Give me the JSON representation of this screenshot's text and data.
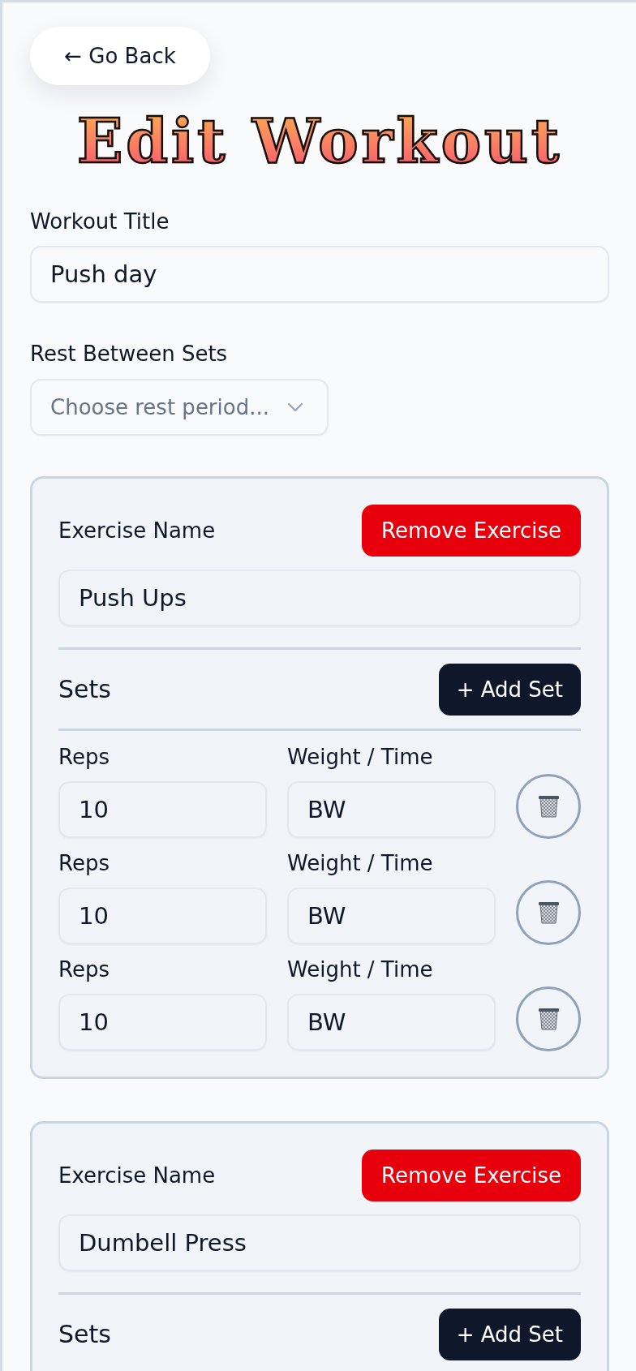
{
  "back_button": {
    "label": "← Go Back"
  },
  "title": "Edit Workout",
  "workout_title": {
    "label": "Workout Title",
    "value": "Push day"
  },
  "rest": {
    "label": "Rest Between Sets",
    "placeholder": "Choose rest period..."
  },
  "exercises": [
    {
      "name_label": "Exercise Name",
      "remove_button": "Remove Exercise",
      "name": "Push Ups",
      "sets_heading": "Sets",
      "add_set_button": "+ Add Set",
      "sets": [
        {
          "reps_label": "Reps",
          "reps": "10",
          "weight_label": "Weight / Time",
          "weight": "BW"
        },
        {
          "reps_label": "Reps",
          "reps": "10",
          "weight_label": "Weight / Time",
          "weight": "BW"
        },
        {
          "reps_label": "Reps",
          "reps": "10",
          "weight_label": "Weight / Time",
          "weight": "BW"
        }
      ]
    },
    {
      "name_label": "Exercise Name",
      "remove_button": "Remove Exercise",
      "name": "Dumbell Press",
      "sets_heading": "Sets",
      "add_set_button": "+ Add Set"
    }
  ]
}
